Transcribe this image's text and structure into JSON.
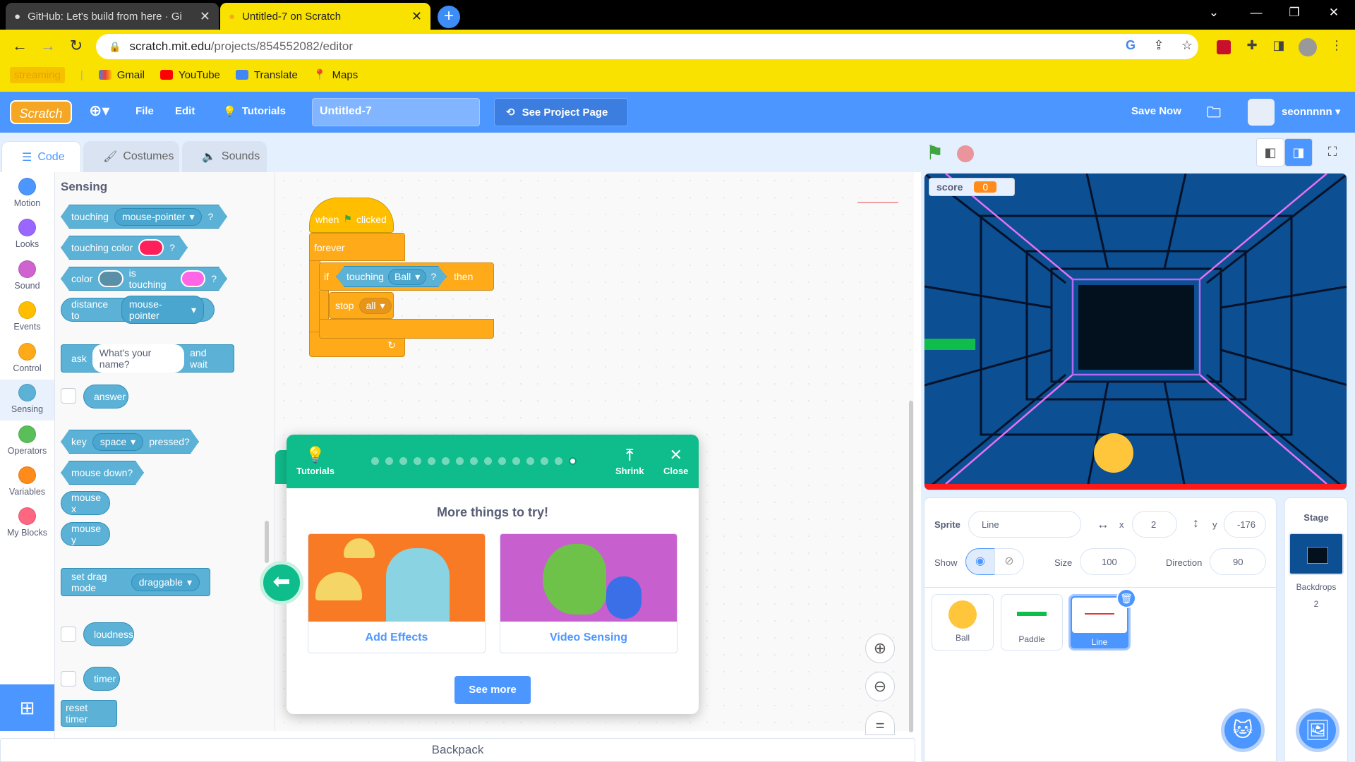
{
  "browser": {
    "tabs": [
      {
        "title": "GitHub: Let's build from here · Gi"
      },
      {
        "title": "Untitled-7 on Scratch"
      }
    ],
    "url_host": "scratch.mit.edu",
    "url_path": "/projects/854552082/editor",
    "bookmarks": [
      "streaming",
      "Gmail",
      "YouTube",
      "Translate",
      "Maps"
    ]
  },
  "menu": {
    "file": "File",
    "edit": "Edit",
    "tutorials": "Tutorials",
    "project_title": "Untitled-7",
    "see_project": "See Project Page",
    "save_now": "Save Now",
    "username": "seonnnnn"
  },
  "editor_tabs": {
    "code": "Code",
    "costumes": "Costumes",
    "sounds": "Sounds"
  },
  "categories": [
    {
      "label": "Motion",
      "color": "#4c97ff"
    },
    {
      "label": "Looks",
      "color": "#9966ff"
    },
    {
      "label": "Sound",
      "color": "#cf63cf"
    },
    {
      "label": "Events",
      "color": "#ffbf00"
    },
    {
      "label": "Control",
      "color": "#ffab19"
    },
    {
      "label": "Sensing",
      "color": "#5cb1d6"
    },
    {
      "label": "Operators",
      "color": "#59c059"
    },
    {
      "label": "Variables",
      "color": "#ff8c1a"
    },
    {
      "label": "My Blocks",
      "color": "#ff6680"
    }
  ],
  "palette": {
    "title": "Sensing",
    "touching": "touching",
    "mouse_pointer": "mouse-pointer",
    "q": "?",
    "touching_color": "touching color",
    "touch_color_value": "#ff1f5a",
    "color": "color",
    "is_touching": "is touching",
    "color_a": "#5a8fa8",
    "color_b": "#ff66e6",
    "distance_to": "distance to",
    "ask": "ask",
    "ask_default": "What's your name?",
    "and_wait": "and wait",
    "answer": "answer",
    "key": "key",
    "space": "space",
    "pressed": "pressed?",
    "mouse_down": "mouse down?",
    "mouse_x": "mouse x",
    "mouse_y": "mouse y",
    "set_drag_mode": "set drag mode",
    "draggable": "draggable",
    "loudness": "loudness",
    "timer": "timer",
    "reset_timer": "reset timer"
  },
  "script": {
    "when": "when",
    "clicked": "clicked",
    "forever": "forever",
    "if": "if",
    "touching": "touching",
    "ball": "Ball",
    "q": "?",
    "then": "then",
    "stop": "stop",
    "all": "all"
  },
  "tutorial": {
    "tutorials": "Tutorials",
    "shrink": "Shrink",
    "close": "Close",
    "heading": "More things to try!",
    "card1": "Add Effects",
    "card2": "Video Sensing",
    "see_more": "See more",
    "dots": 15,
    "active_dot": 15
  },
  "backpack": "Backpack",
  "stage": {
    "score_label": "score",
    "score_value": "0"
  },
  "sprite_info": {
    "sprite_label": "Sprite",
    "sprite_name": "Line",
    "x_label": "x",
    "x": "2",
    "y_label": "y",
    "y": "-176",
    "show_label": "Show",
    "size_label": "Size",
    "size": "100",
    "direction_label": "Direction",
    "direction": "90"
  },
  "sprites": [
    {
      "name": "Ball"
    },
    {
      "name": "Paddle"
    },
    {
      "name": "Line"
    }
  ],
  "stage_pane": {
    "title": "Stage",
    "backdrops_label": "Backdrops",
    "backdrops_count": "2"
  }
}
